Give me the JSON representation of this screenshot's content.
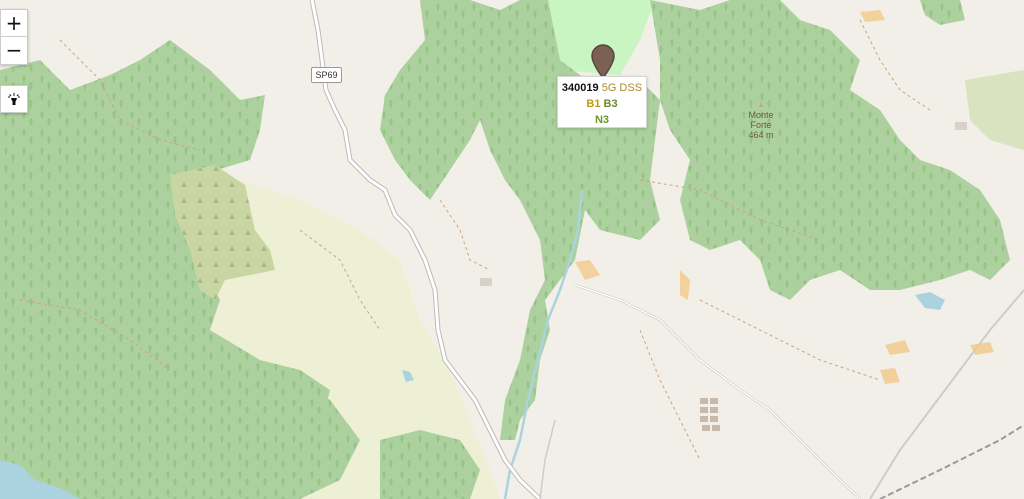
{
  "controls": {
    "zoom_in": "+",
    "zoom_out": "−",
    "torch_icon": "flashlight-icon"
  },
  "map": {
    "road_ref": "SP69",
    "peak_name": "Monte\nForte",
    "peak_elev": "464 m"
  },
  "popup": {
    "site_id": "340019",
    "tech": "5G DSS",
    "band_1": "B1",
    "band_2": "B3",
    "band_3": "N3"
  },
  "colors": {
    "forest": "#add19e",
    "land": "#f2efe9",
    "meadow": "#eef0d5",
    "water": "#aad3df",
    "pin": "#7a6154"
  }
}
